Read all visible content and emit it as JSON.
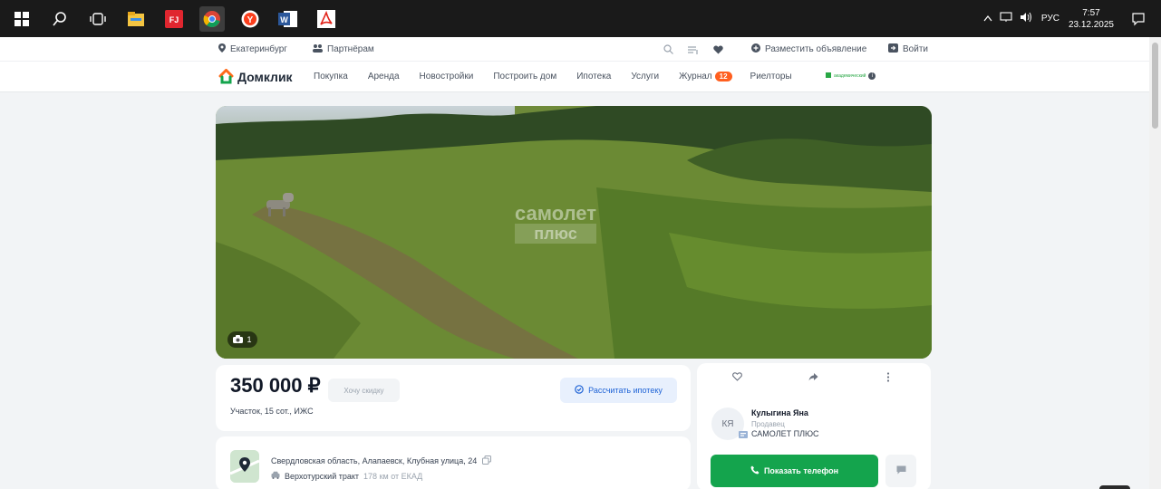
{
  "taskbar": {
    "apps": [
      {
        "icon": "windows-start-icon"
      },
      {
        "icon": "search-icon"
      },
      {
        "icon": "task-view-icon"
      },
      {
        "icon": "file-explorer-icon"
      },
      {
        "icon": "fj-app-icon",
        "label": "FJ"
      },
      {
        "icon": "chrome-icon"
      },
      {
        "icon": "yandex-browser-icon",
        "label": "Y"
      },
      {
        "icon": "word-icon",
        "label": "W"
      },
      {
        "icon": "acrobat-icon"
      }
    ],
    "lang": "РУС",
    "time": "7:57",
    "date": "23.12.2025"
  },
  "topbar": {
    "city": "Екатеринбург",
    "partners": "Партнёрам",
    "post_ad": "Разместить объявление",
    "login": "Войти"
  },
  "nav": {
    "logo": "Домклик",
    "items": [
      "Покупка",
      "Аренда",
      "Новостройки",
      "Построить дом",
      "Ипотека",
      "Услуги"
    ],
    "journal": "Журнал",
    "journal_badge": "12",
    "realtors": "Риелторы",
    "academic": "академический"
  },
  "photo": {
    "count": "1",
    "watermark_top": "самолет",
    "watermark_bottom": "плюс"
  },
  "listing": {
    "price": "350 000 ₽",
    "discount_label": "Хочу скидку",
    "mortgage_label": "Рассчитать ипотеку",
    "description": "Участок, 15 сот., ИЖС",
    "address": "Свердловская область, Алапаевск, Клубная улица, 24",
    "road": "Верхотурский тракт",
    "road_distance": "178 км от ЕКАД"
  },
  "seller": {
    "initials": "КЯ",
    "name": "Кулыгина Яна",
    "role": "Продавец",
    "agency": "САМОЛЕТ ПЛЮС",
    "phone_label": "Показать телефон"
  },
  "colors": {
    "brand_green": "#14a44d",
    "badge_orange": "#ff5f1f",
    "mortgage_blue": "#1f63d6"
  }
}
